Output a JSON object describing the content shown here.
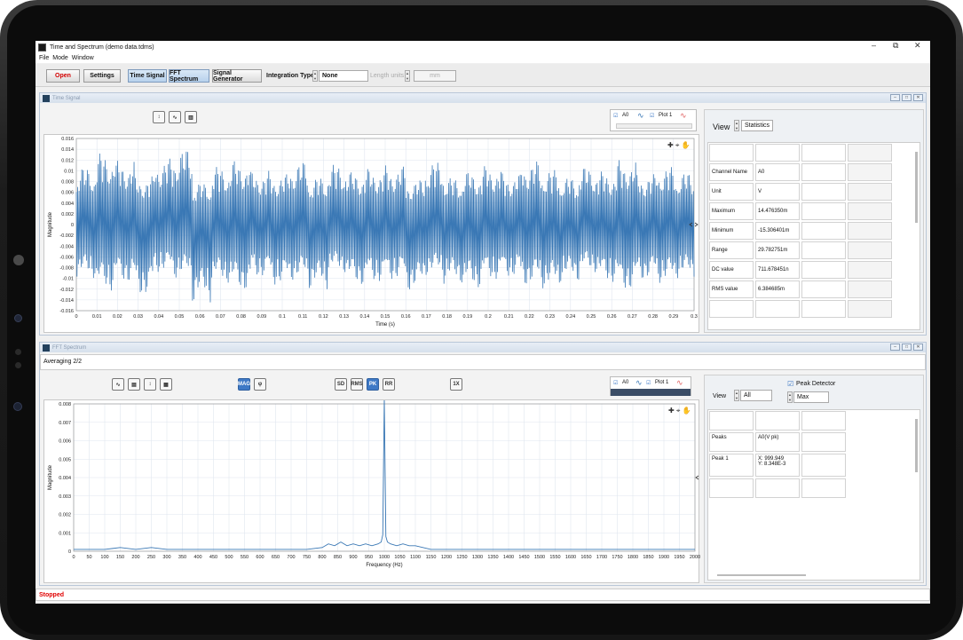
{
  "window": {
    "title": "Time and Spectrum (demo data.tdms)",
    "min": "–",
    "max": "⧉",
    "close": "✕"
  },
  "menu": [
    "File",
    "Mode",
    "Window"
  ],
  "toolbar": {
    "open": "Open",
    "settings": "Settings",
    "time_signal": "Time Signal",
    "fft_spectrum": "FFT Spectrum",
    "signal_generator": "Signal Generator",
    "integration_type_label": "Integration Type",
    "integration_type_value": "None",
    "length_units_label": "Length units",
    "length_units_value": "mm"
  },
  "time_panel": {
    "title": "Time Signal",
    "legend": {
      "channel": "A0",
      "plot": "Plot 1"
    },
    "view_label": "View",
    "view_value": "Statistics",
    "stats": [
      {
        "name": "Channel Name",
        "value": "A0"
      },
      {
        "name": "Unit",
        "value": "V"
      },
      {
        "name": "Maximum",
        "value": "14.476350m"
      },
      {
        "name": "Minimum",
        "value": "-15.306401m"
      },
      {
        "name": "Range",
        "value": "29.782751m"
      },
      {
        "name": "DC value",
        "value": "711.678451n"
      },
      {
        "name": "RMS value",
        "value": "6.384685m"
      }
    ]
  },
  "fft_panel": {
    "title": "FFT Spectrum",
    "averaging": "Averaging 2/2",
    "legend": {
      "channel": "A0",
      "plot": "Plot 1"
    },
    "view_label": "View",
    "view_value": "All",
    "peak_detector_label": "Peak Detector",
    "peak_mode": "Max",
    "peaks_header": {
      "name": "Peaks",
      "value": "A0(V pk)"
    },
    "peak1": {
      "name": "Peak 1",
      "x": "X: 999.949",
      "y": "Y: 8.348E-3"
    },
    "toolbar_buttons": [
      "SD",
      "RMS",
      "PK",
      "RR",
      "1X",
      "MAG"
    ]
  },
  "status": "Stopped",
  "colors": {
    "signal": "#3a78b5",
    "accent": "#3e79c6",
    "status_text": "#e00000"
  },
  "chart_data": [
    {
      "type": "line",
      "xlabel": "Time (s)",
      "ylabel": "Magnitude",
      "xlim": [
        0,
        0.3
      ],
      "ylim": [
        -0.016,
        0.016
      ],
      "xticks": [
        "0",
        "0.01",
        "0.02",
        "0.03",
        "0.04",
        "0.05",
        "0.06",
        "0.07",
        "0.08",
        "0.09",
        "0.1",
        "0.11",
        "0.12",
        "0.13",
        "0.14",
        "0.15",
        "0.16",
        "0.17",
        "0.18",
        "0.19",
        "0.2",
        "0.21",
        "0.22",
        "0.23",
        "0.24",
        "0.25",
        "0.26",
        "0.27",
        "0.28",
        "0.29",
        "0.3"
      ],
      "yticks": [
        "0.016",
        "0.014",
        "0.012",
        "0.01",
        "0.008",
        "0.006",
        "0.004",
        "0.002",
        "0",
        "-0.002",
        "-0.004",
        "-0.006",
        "-0.008",
        "-0.01",
        "-0.012",
        "-0.014",
        "-0.016"
      ],
      "series": [
        {
          "values": [
            0.011,
            0.0135,
            0.012,
            0.009,
            0.0125,
            0.0145,
            0.008,
            0.011,
            0.012,
            0.01,
            0.0095,
            0.012,
            0.009,
            0.0115,
            0.01,
            0.0105,
            0.011,
            0.0085,
            0.012,
            0.009,
            0.01,
            0.011,
            0.0095,
            0.012,
            0.0105,
            0.009,
            0.011,
            0.01,
            0.012,
            0.0095,
            0.011,
            0.01
          ]
        }
      ],
      "minima": [
        -0.01,
        -0.0125,
        -0.011,
        -0.0135,
        -0.009,
        -0.01,
        -0.0145,
        -0.011,
        -0.0125,
        -0.01,
        -0.0115,
        -0.0105,
        -0.012,
        -0.009,
        -0.0115,
        -0.011,
        -0.0105,
        -0.0125,
        -0.0095,
        -0.011,
        -0.012,
        -0.0105,
        -0.01,
        -0.0115,
        -0.012,
        -0.0105,
        -0.009,
        -0.011,
        -0.0125,
        -0.0105,
        -0.011,
        -0.01
      ]
    },
    {
      "type": "line",
      "xlabel": "Frequency (Hz)",
      "ylabel": "Magnitude",
      "xlim": [
        0,
        2000
      ],
      "ylim": [
        0,
        0.008
      ],
      "xticks": [
        "0",
        "50",
        "100",
        "150",
        "200",
        "250",
        "300",
        "350",
        "400",
        "450",
        "500",
        "550",
        "600",
        "650",
        "700",
        "750",
        "800",
        "850",
        "900",
        "950",
        "1000",
        "1050",
        "1100",
        "1150",
        "1200",
        "1250",
        "1300",
        "1350",
        "1400",
        "1450",
        "1500",
        "1550",
        "1600",
        "1650",
        "1700",
        "1750",
        "1800",
        "1850",
        "1900",
        "1950",
        "2000"
      ],
      "yticks": [
        "0.008",
        "0.007",
        "0.006",
        "0.005",
        "0.004",
        "0.003",
        "0.002",
        "0.001",
        "0"
      ],
      "series": [
        {
          "x": [
            0,
            100,
            150,
            200,
            250,
            300,
            400,
            500,
            600,
            700,
            750,
            800,
            820,
            840,
            860,
            880,
            900,
            920,
            940,
            960,
            980,
            990,
            995,
            999.949,
            1005,
            1010,
            1020,
            1040,
            1060,
            1080,
            1100,
            1150,
            1200,
            1300,
            1400,
            1500,
            1600,
            1800,
            2000
          ],
          "y": [
            0.0001,
            0.0001,
            0.0002,
            0.0001,
            0.0002,
            0.0001,
            0.0001,
            0.0001,
            0.0001,
            0.0001,
            0.0001,
            0.0002,
            0.0004,
            0.0003,
            0.0005,
            0.0003,
            0.0004,
            0.0003,
            0.0004,
            0.0003,
            0.0004,
            0.0005,
            0.0009,
            0.008348,
            0.0008,
            0.0005,
            0.0004,
            0.0003,
            0.0004,
            0.0003,
            0.0003,
            0.0001,
            0.0001,
            0.0001,
            0.0001,
            0.0001,
            0.0001,
            0.0001,
            0.0001
          ]
        }
      ]
    }
  ]
}
